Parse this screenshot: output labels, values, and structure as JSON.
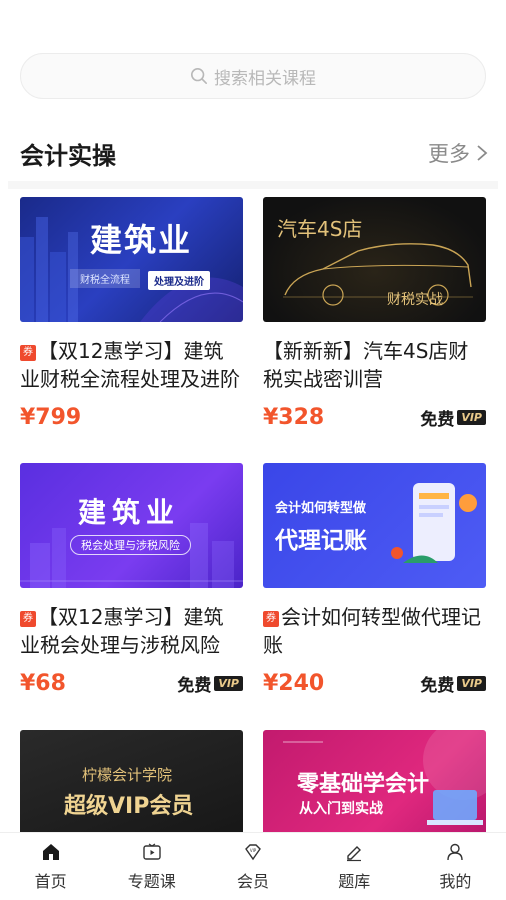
{
  "search": {
    "placeholder": "搜索相关课程"
  },
  "section": {
    "title": "会计实操",
    "more_label": "更多"
  },
  "courses": [
    {
      "coupon": "券",
      "title": "【双12惠学习】建筑业财税全流程处理及进阶",
      "price": "¥799",
      "free_label": "",
      "thumb": {
        "big": "建筑业",
        "tag1": "财税全流程",
        "tag2": "处理及进阶"
      }
    },
    {
      "coupon": "",
      "title": "【新新新】汽车4S店财税实战密训营",
      "price": "¥328",
      "free_label": "免费",
      "vip_label": "VIP",
      "thumb": {
        "big": "汽车4S店",
        "tag1": "财税实战"
      }
    },
    {
      "coupon": "券",
      "title": "【双12惠学习】建筑业税会处理与涉税风险",
      "price": "¥68",
      "free_label": "免费",
      "vip_label": "VIP",
      "thumb": {
        "big": "建筑业",
        "tag1": "税会处理与涉税风险"
      }
    },
    {
      "coupon": "券",
      "title": "会计如何转型做代理记账",
      "price": "¥240",
      "free_label": "免费",
      "vip_label": "VIP",
      "thumb": {
        "small": "会计如何转型做",
        "big": "代理记账"
      }
    },
    {
      "thumb": {
        "small": "柠檬会计学院",
        "big": "超级VIP会员"
      }
    },
    {
      "thumb": {
        "big": "零基础学会计",
        "small": "从入门到实战"
      }
    }
  ],
  "tabs": [
    {
      "label": "首页",
      "icon": "home-icon"
    },
    {
      "label": "专题课",
      "icon": "play-box-icon"
    },
    {
      "label": "会员",
      "icon": "vip-diamond-icon"
    },
    {
      "label": "题库",
      "icon": "pen-icon"
    },
    {
      "label": "我的",
      "icon": "person-icon"
    }
  ],
  "colors": {
    "accent": "#f2552c",
    "coupon": "#ef4a2e",
    "vip_gold": "#e9c98a"
  }
}
